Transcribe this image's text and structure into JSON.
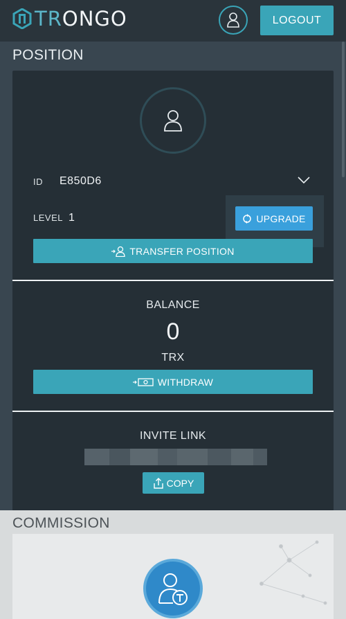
{
  "header": {
    "logo_text_accent": "TR",
    "logo_text_main": "ONGO",
    "logout_label": "LOGOUT",
    "avatar_icon": "user-icon"
  },
  "position": {
    "title": "POSITION",
    "id_label": "ID",
    "id_value": "E850D6",
    "level_label": "LEVEL",
    "level_value": "1",
    "upgrade_label": "UPGRADE",
    "transfer_label": "TRANSFER POSITION",
    "balance_label": "BALANCE",
    "balance_value": "0",
    "balance_unit": "TRX",
    "withdraw_label": "WITHDRAW",
    "invite_label": "INVITE LINK",
    "copy_label": "COPY"
  },
  "commission": {
    "title": "COMMISSION"
  },
  "colors": {
    "accent": "#3aa5b8",
    "upgrade": "#3aa0dc",
    "background": "#394650",
    "card": "#252f36",
    "header": "#2a343b"
  }
}
